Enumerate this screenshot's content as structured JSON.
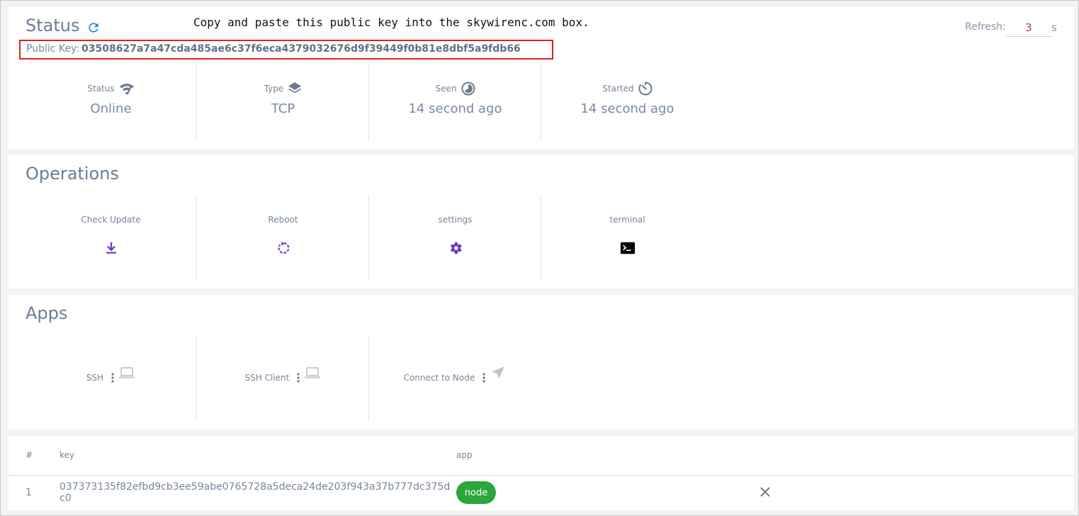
{
  "status": {
    "title": "Status",
    "note": "Copy and paste this public key into the skywirenc.com box.",
    "refresh": {
      "label": "Refresh:",
      "value": "3",
      "unit": "s"
    },
    "public_key": {
      "label": "Public Key:",
      "value": "03508627a7a47cda485ae6c37f6eca4379032676d9f39449f0b81e8dbf5a9fdb66"
    },
    "stats": [
      {
        "label": "Status",
        "value": "Online",
        "icon": "wifi-icon"
      },
      {
        "label": "Type",
        "value": "TCP",
        "icon": "layers-icon"
      },
      {
        "label": "Seen",
        "value": "14 second ago",
        "icon": "pie-clock-icon"
      },
      {
        "label": "Started",
        "value": "14 second ago",
        "icon": "timer-icon"
      }
    ]
  },
  "operations": {
    "title": "Operations",
    "items": [
      {
        "label": "Check Update",
        "icon": "download-icon"
      },
      {
        "label": "Reboot",
        "icon": "reboot-icon"
      },
      {
        "label": "settings",
        "icon": "gear-icon"
      },
      {
        "label": "terminal",
        "icon": "terminal-icon"
      }
    ]
  },
  "apps": {
    "title": "Apps",
    "items": [
      {
        "label": "SSH",
        "icon": "laptop-icon"
      },
      {
        "label": "SSH Client",
        "icon": "laptop-icon"
      },
      {
        "label": "Connect to Node",
        "icon": "send-icon"
      }
    ]
  },
  "table": {
    "headers": {
      "num": "#",
      "key": "key",
      "app": "app"
    },
    "rows": [
      {
        "num": "1",
        "key": "037373135f82efbd9cb3ee59abe0765728a5deca24de203f943a37b777dc375dc0",
        "app": "node"
      }
    ]
  },
  "colors": {
    "accent_purple": "#6a3cc2",
    "refresh_blue": "#1e88e5",
    "badge_green": "#2ba63d",
    "highlight_red": "#d9241d"
  }
}
